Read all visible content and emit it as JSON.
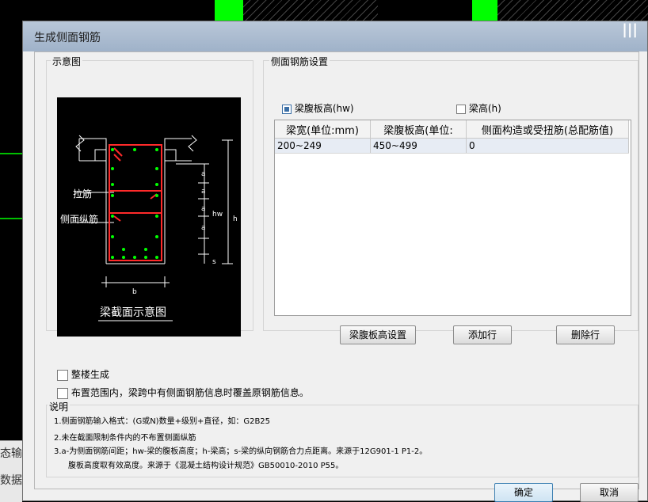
{
  "dialog": {
    "title": "生成侧面钢筋",
    "window_control": "|||"
  },
  "diagram_group": {
    "label": "示意图",
    "labels": {
      "tie_bar": "拉筋",
      "side_longitudinal": "侧面纵筋",
      "a": "a",
      "hw": "hw",
      "h": "h",
      "s": "s",
      "b": "b",
      "caption": "梁截面示意图"
    }
  },
  "settings_group": {
    "label": "侧面钢筋设置",
    "options": [
      {
        "label": "梁腹板高(hw)",
        "checked": true
      },
      {
        "label": "梁高(h)",
        "checked": false
      }
    ],
    "table": {
      "headers": [
        "梁宽(单位:mm)",
        "梁腹板高(单位:",
        "侧面构造或受扭筋(总配筋值)"
      ],
      "rows": [
        [
          "200~249",
          "450~499",
          "0"
        ]
      ]
    },
    "buttons": {
      "web_height": "梁腹板高设置",
      "add_row": "添加行",
      "delete_row": "删除行"
    }
  },
  "bottom_options": {
    "whole_building": "整楼生成",
    "overwrite": "布置范围内，梁跨中有侧面钢筋信息时覆盖原钢筋信息。"
  },
  "notes": {
    "label": "说明",
    "lines": [
      "1.侧面钢筋输入格式：(G或N)数量+级别+直径，如：G2B25",
      "2.未在截面限制条件内的不布置侧面纵筋",
      "3.a-为侧面钢筋间距；hw-梁的腹板高度；h-梁高；s-梁的纵向钢筋合力点距离。来源于12G901-1 P1-2。",
      "腹板高度取有效高度。来源于《混凝土结构设计规范》GB50010-2010 P55。"
    ]
  },
  "footer": {
    "ok": "确定",
    "cancel": "取消"
  },
  "background": {
    "left_text_1": "态输",
    "left_text_2": "数据"
  },
  "colors": {
    "green": "#00ff00",
    "diagram_red": "#ff2a2a",
    "diagram_dot": "#00ff00"
  }
}
